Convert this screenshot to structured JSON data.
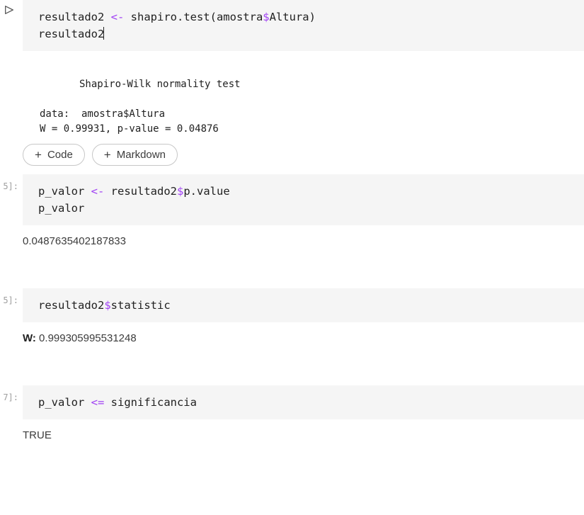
{
  "cells": [
    {
      "prompt": "",
      "code": {
        "line1_a": "resultado2 ",
        "line1_op": "<-",
        "line1_b": " shapiro.test(amostra",
        "line1_dollar": "$",
        "line1_c": "Altura)",
        "line2": "resultado2"
      }
    },
    {
      "output_title": "Shapiro-Wilk normality test",
      "output_data": "data:  amostra$Altura",
      "output_stats": "W = 0.99931, p-value = 0.04876"
    },
    {
      "buttons": {
        "code_label": "Code",
        "markdown_label": "Markdown"
      }
    },
    {
      "prompt": "5]:",
      "code": {
        "line1_a": "p_valor ",
        "line1_op": "<-",
        "line1_b": " resultado2",
        "line1_dollar": "$",
        "line1_c": "p.value",
        "line2": "p_valor"
      },
      "output": "0.0487635402187833"
    },
    {
      "prompt": "5]:",
      "code": {
        "line1_a": "resultado2",
        "line1_dollar": "$",
        "line1_b": "statistic"
      },
      "output_label": "W:",
      "output_value": " 0.999305995531248"
    },
    {
      "prompt": "7]:",
      "code": {
        "line1_a": "p_valor ",
        "line1_op": "<=",
        "line1_b": " significancia"
      },
      "output": "TRUE"
    }
  ]
}
